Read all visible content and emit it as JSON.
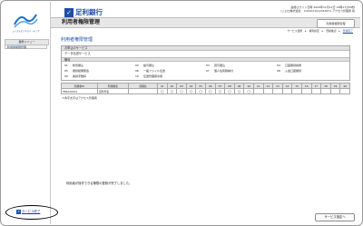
{
  "sidebar": {
    "logo_caption": "ふくぎんビジネスバンキング",
    "menu_heading": "業務メニュー",
    "menu_item": "利用者権限管理",
    "service_end_label": "サービス終了"
  },
  "header": {
    "bank_name": "足利銀行",
    "info_line1": "最終ログイン日時 2009年11月12日 16時11分08秒",
    "info_line2": "○△ロロ株式会社　1010021012345671 アクセス管理者 様"
  },
  "title_bar": {
    "title": "利用者権限管理",
    "tab_label": "利用者権限管理"
  },
  "breadcrumb": [
    "サービス選択",
    "権利指定",
    "登録確認",
    "登録完了"
  ],
  "section_title": "利用者権限管理",
  "service_panel": {
    "heading": "お申込のサービス",
    "service_name": "データ伝送サービス",
    "subheading": "権利",
    "items": [
      {
        "no": "01",
        "label": "総合振込"
      },
      {
        "no": "02",
        "label": "給与振込"
      },
      {
        "no": "03",
        "label": "賞与振込"
      },
      {
        "no": "04",
        "label": "口座振替請求"
      },
      {
        "no": "05",
        "label": "振替結果照会"
      },
      {
        "no": "06",
        "label": "一般ファイル伝送"
      },
      {
        "no": "07",
        "label": "個人住民税納付"
      },
      {
        "no": "08",
        "label": "入金口座振替"
      },
      {
        "no": "09",
        "label": "為替手数料"
      },
      {
        "no": "10",
        "label": "伝送管理者専用"
      }
    ]
  },
  "rights_table": {
    "headers": [
      "利用者ID",
      "利用者名",
      "部署名",
      "01",
      "02",
      "03",
      "04",
      "05",
      "06",
      "07",
      "08",
      "09",
      "10",
      "11",
      "12",
      "13",
      "14",
      "15",
      "16",
      "17",
      "18",
      "19",
      "20"
    ],
    "rows": [
      {
        "user_id": "FB2222222",
        "user_name": "足利代表",
        "dept": "",
        "marks": [
          "○",
          "○",
          "○",
          "○",
          "○",
          "○",
          "○",
          "○",
          "○",
          "○",
          "",
          "",
          "",
          "",
          "",
          "",
          "",
          "",
          "",
          ""
        ]
      }
    ],
    "admin_note": "＊青字太字はアクセス管理者"
  },
  "message": "利用者が操作できる権限の登録が完了しました。",
  "bottom_button": "サービス指定へ"
}
